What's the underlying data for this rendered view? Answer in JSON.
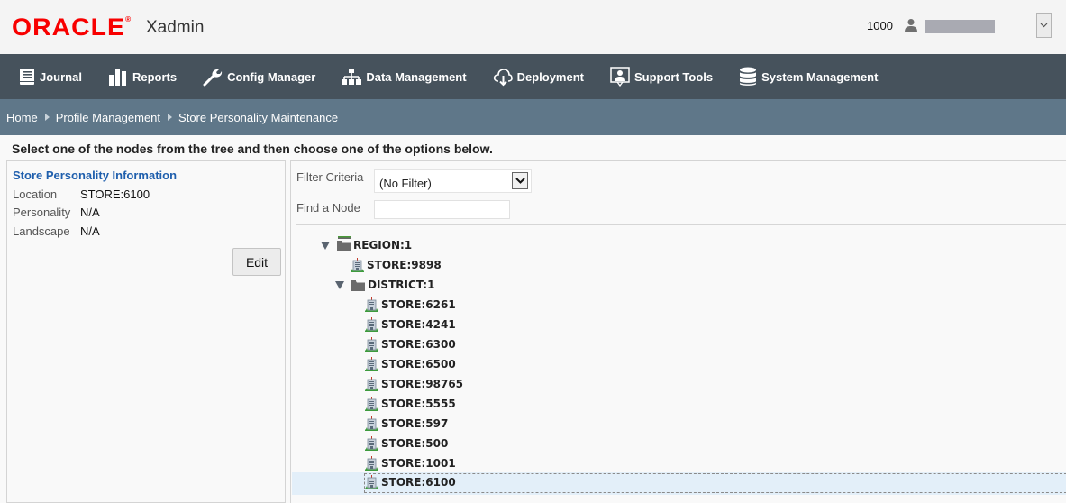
{
  "header": {
    "brand": "ORACLE",
    "app_name": "Xadmin",
    "user_code": "1000",
    "user_icon": "person-icon",
    "user_menu_icon": "chevron-down-icon"
  },
  "nav": {
    "items": [
      {
        "label": "Journal",
        "icon": "journal-icon"
      },
      {
        "label": "Reports",
        "icon": "bar-chart-icon"
      },
      {
        "label": "Config Manager",
        "icon": "wrench-icon"
      },
      {
        "label": "Data Management",
        "icon": "hierarchy-icon"
      },
      {
        "label": "Deployment",
        "icon": "cloud-download-icon"
      },
      {
        "label": "Support Tools",
        "icon": "support-icon"
      },
      {
        "label": "System Management",
        "icon": "database-icon"
      }
    ]
  },
  "breadcrumb": {
    "items": [
      "Home",
      "Profile Management",
      "Store Personality Maintenance"
    ]
  },
  "instruction": "Select one of the nodes from the tree and then choose one of the options below.",
  "info_panel": {
    "title": "Store Personality Information",
    "rows": [
      {
        "label": "Location",
        "value": "STORE:6100"
      },
      {
        "label": "Personality",
        "value": "N/A"
      },
      {
        "label": "Landscape",
        "value": "N/A"
      }
    ],
    "edit_label": "Edit"
  },
  "tree_panel": {
    "filter_label": "Filter Criteria",
    "filter_value": "(No Filter)",
    "find_label": "Find a Node",
    "find_value": "",
    "nodes": [
      {
        "label": "REGION:1",
        "type": "folder",
        "expanded": true,
        "level": 0
      },
      {
        "label": "STORE:9898",
        "type": "store",
        "level": 1
      },
      {
        "label": "DISTRICT:1",
        "type": "folder",
        "expanded": true,
        "level": 1
      },
      {
        "label": "STORE:6261",
        "type": "store",
        "level": 2
      },
      {
        "label": "STORE:4241",
        "type": "store",
        "level": 2
      },
      {
        "label": "STORE:6300",
        "type": "store",
        "level": 2
      },
      {
        "label": "STORE:6500",
        "type": "store",
        "level": 2
      },
      {
        "label": "STORE:98765",
        "type": "store",
        "level": 2
      },
      {
        "label": "STORE:5555",
        "type": "store",
        "level": 2
      },
      {
        "label": "STORE:597",
        "type": "store",
        "level": 2
      },
      {
        "label": "STORE:500",
        "type": "store",
        "level": 2
      },
      {
        "label": "STORE:1001",
        "type": "store",
        "level": 2
      },
      {
        "label": "STORE:6100",
        "type": "store",
        "level": 2,
        "selected": true
      }
    ]
  },
  "colors": {
    "brand_red": "#f80000",
    "nav_bg": "#46525c",
    "breadcrumb_bg": "#5f7789",
    "link_blue": "#1f5fad",
    "selection_bg": "#e3eff9"
  }
}
